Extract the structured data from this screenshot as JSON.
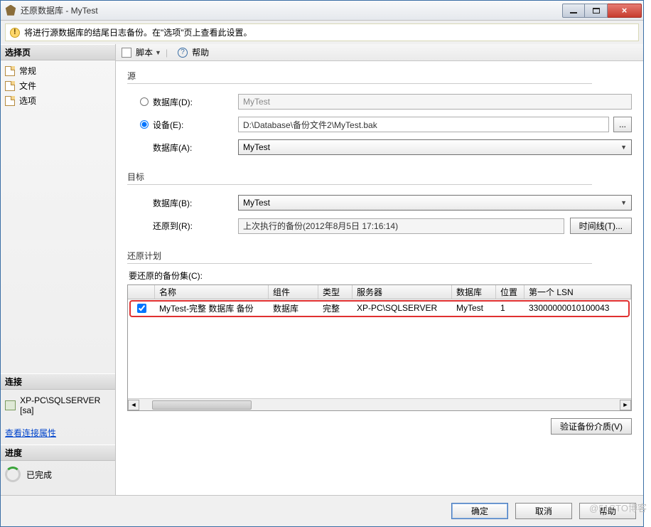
{
  "titlebar": {
    "title": "还原数据库 - MyTest"
  },
  "info_bar": {
    "text": "将进行源数据库的结尾日志备份。在\"选项\"页上查看此设置。"
  },
  "sidebar": {
    "header_select": "选择页",
    "items": [
      "常规",
      "文件",
      "选项"
    ],
    "header_conn": "连接",
    "connection": "XP-PC\\SQLSERVER [sa]",
    "view_props": "查看连接属性",
    "header_progress": "进度",
    "progress_text": "已完成"
  },
  "toolbar": {
    "script": "脚本",
    "help": "帮助"
  },
  "source": {
    "legend": "源",
    "db_label": "数据库(D):",
    "db_value": "MyTest",
    "device_label": "设备(E):",
    "device_value": "D:\\Database\\备份文件2\\MyTest.bak",
    "dbA_label": "数据库(A):",
    "dbA_value": "MyTest",
    "browse": "..."
  },
  "target": {
    "legend": "目标",
    "db_label": "数据库(B):",
    "db_value": "MyTest",
    "restore_to_label": "还原到(R):",
    "restore_to_value": "上次执行的备份(2012年8月5日 17:16:14)",
    "timeline_btn": "时间线(T)..."
  },
  "plan": {
    "legend": "还原计划",
    "sets_label": "要还原的备份集(C):",
    "headers": {
      "name": "名称",
      "component": "组件",
      "type": "类型",
      "server": "服务器",
      "database": "数据库",
      "position": "位置",
      "first_lsn": "第一个 LSN"
    },
    "rows": [
      {
        "checked": true,
        "name": "MyTest-完整 数据库 备份",
        "component": "数据库",
        "type": "完整",
        "server": "XP-PC\\SQLSERVER",
        "database": "MyTest",
        "position": "1",
        "first_lsn": "33000000010100043"
      }
    ],
    "verify_btn": "验证备份介质(V)"
  },
  "footer": {
    "ok": "确定",
    "cancel": "取消",
    "help": "帮助"
  },
  "watermark": "@51CTO博客"
}
